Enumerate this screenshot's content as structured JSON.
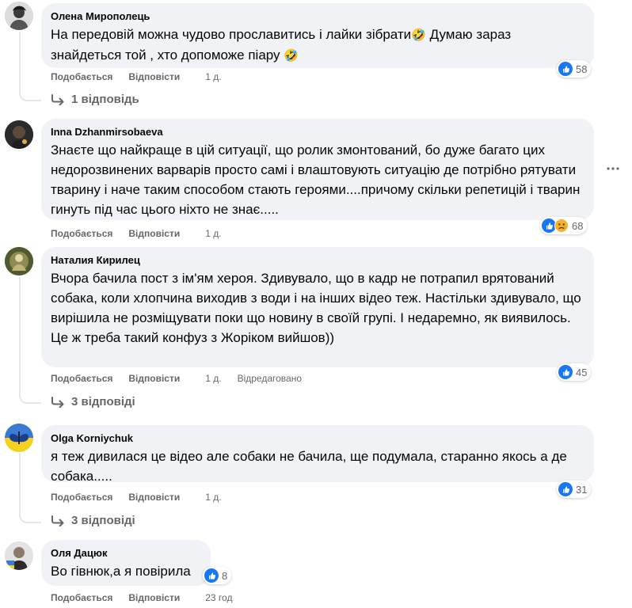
{
  "colors": {
    "bubble": "#f0f2f5",
    "meta": "#65676b",
    "like": "#1877f2",
    "sad": "#f7b125"
  },
  "actions": {
    "like": "Подобається",
    "reply": "Відповісти"
  },
  "comments": [
    {
      "author": "Олена Мирополець",
      "text_a": "На передовій можна чудово прославитись і лайки зібрати",
      "emoji_a": "🤣",
      "text_b": " Думаю зараз знайдеться той , хто допоможе піару ",
      "emoji_b": "🤣",
      "reactions": [
        "like-icon"
      ],
      "reaction_count": "58",
      "time": "1 д.",
      "replies": "1 відповідь"
    },
    {
      "author": "Inna Dzhanmirsobaeva",
      "text": "Знаєте що найкраще в цій ситуації, що ролик змонтований, бо дуже багато цих недорозвинених варварів просто самі і влаштовують ситуацію де потрібно рятувати тварину і наче таким способом стають героями....причому скільки репетицій і тварин гинуть під час цього ніхто не знає.....",
      "reactions": [
        "like-icon",
        "sad-icon"
      ],
      "reaction_count": "68",
      "time": "1 д."
    },
    {
      "author": "Наталия Кирилец",
      "text": "Вчора бачила пост з ім'ям хероя. Здивувало, що в кадр не потрапил врятований собака, коли хлопчина виходив з води і на інших відео теж. Настільки здивувало, що вирішила не розміщувати поки що новину в своїй групі. І недаремно, як виявилось.\nЦе ж треба такий конфуз з Жоріком вийшов))",
      "reactions": [
        "like-icon"
      ],
      "reaction_count": "45",
      "time": "1 д.",
      "edited": "Відредаговано",
      "replies": "3 відповіді"
    },
    {
      "author": "Olga Korniychuk",
      "text": "я теж дивилася це відео але собаки не бачила, ще подумала, старанно якось а де собака.....",
      "reactions": [
        "like-icon"
      ],
      "reaction_count": "31",
      "time": "1 д.",
      "replies": "3 відповіді"
    },
    {
      "author": "Оля Дацюк",
      "text": "Во гівнюк,а я повірила",
      "reactions": [
        "like-icon"
      ],
      "reaction_count": "8",
      "time": "23 год"
    }
  ]
}
